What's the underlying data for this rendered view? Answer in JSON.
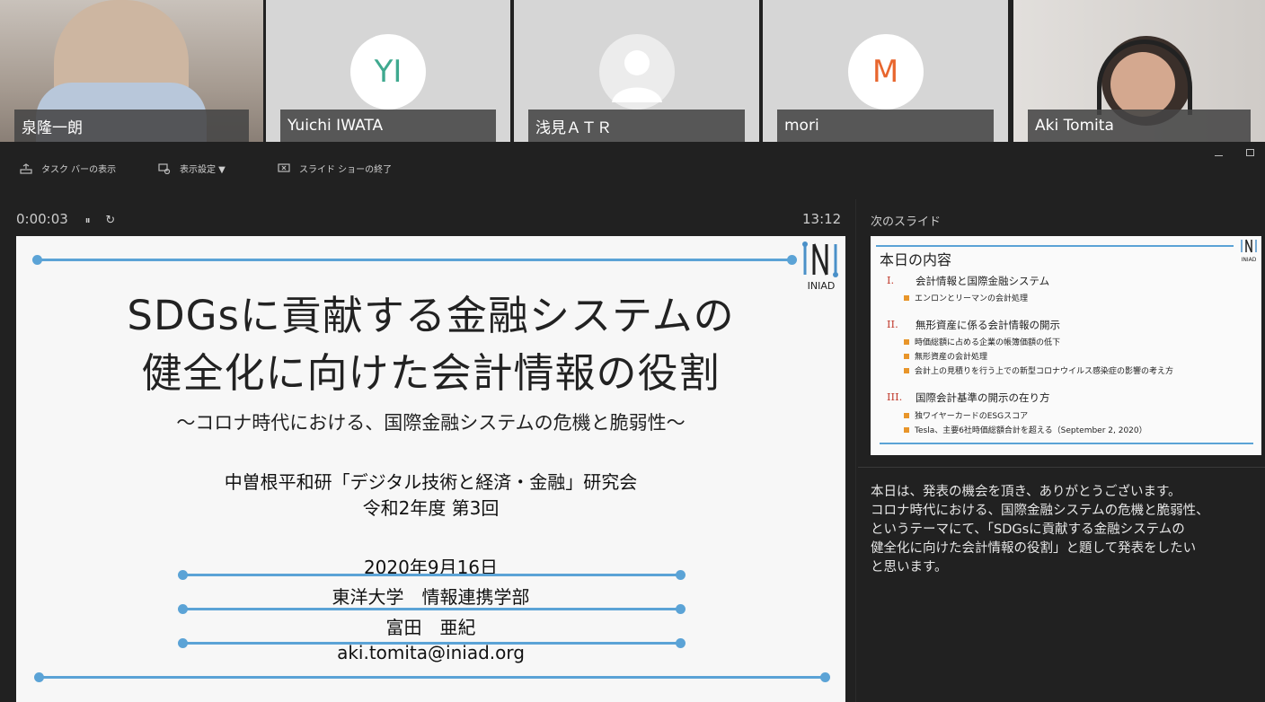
{
  "participants": [
    {
      "name": "泉隆一朗",
      "initials": ""
    },
    {
      "name": "Yuichi IWATA",
      "initials": "YI"
    },
    {
      "name": "浅見ＡＴＲ",
      "initials": ""
    },
    {
      "name": "mori",
      "initials": "M"
    },
    {
      "name": "Aki Tomita",
      "initials": ""
    }
  ],
  "colors": {
    "yi_initials": "#3fa98f",
    "m_initials": "#e8662e"
  },
  "toolbar": {
    "taskbar": "タスク バーの表示",
    "display_settings": "表示設定 ▼",
    "end_show": "スライド ショーの終了"
  },
  "timer": {
    "elapsed": "0:00:03",
    "pause_glyph": "⏸",
    "restart_glyph": "↻",
    "clock": "13:12"
  },
  "slide": {
    "logo": "INIAD",
    "title_line1": "SDGsに貢献する金融システムの",
    "title_line2": "健全化に向けた会計情報の役割",
    "subtitle": "～コロナ時代における、国際金融システムの危機と脆弱性～",
    "org_line1": "中曽根平和研「デジタル技術と経済・金融」研究会",
    "org_line2": "令和2年度 第3回",
    "date": "2020年9月16日",
    "affiliation": "東洋大学　情報連携学部",
    "presenter": "富田　亜紀",
    "email": "aki.tomita@iniad.org"
  },
  "next_slide": {
    "label": "次のスライド",
    "logo": "INIAD",
    "title": "本日の内容",
    "sections": [
      {
        "roman": "I.",
        "text": "会計情報と国際金融システム",
        "bullets": [
          "エンロンとリーマンの会計処理"
        ]
      },
      {
        "roman": "II.",
        "text": "無形資産に係る会計情報の開示",
        "bullets": [
          "時価総額に占める企業の帳簿価額の低下",
          "無形資産の会計処理",
          "会計上の見積りを行う上での新型コロナウイルス感染症の影響の考え方"
        ]
      },
      {
        "roman": "III.",
        "text": "国際会計基準の開示の在り方",
        "bullets": [
          "独ワイヤーカードのESGスコア",
          "Tesla、主要6社時価総額合計を超える（September 2, 2020）"
        ]
      }
    ]
  },
  "notes": {
    "line1": "本日は、発表の機会を頂き、ありがとうございます。",
    "line2": "コロナ時代における、国際金融システムの危機と脆弱性、",
    "line3": "というテーマにて、「SDGsに貢献する金融システムの",
    "line4": "健全化に向けた会計情報の役割」と題して発表をしたい",
    "line5": "と思います。"
  }
}
